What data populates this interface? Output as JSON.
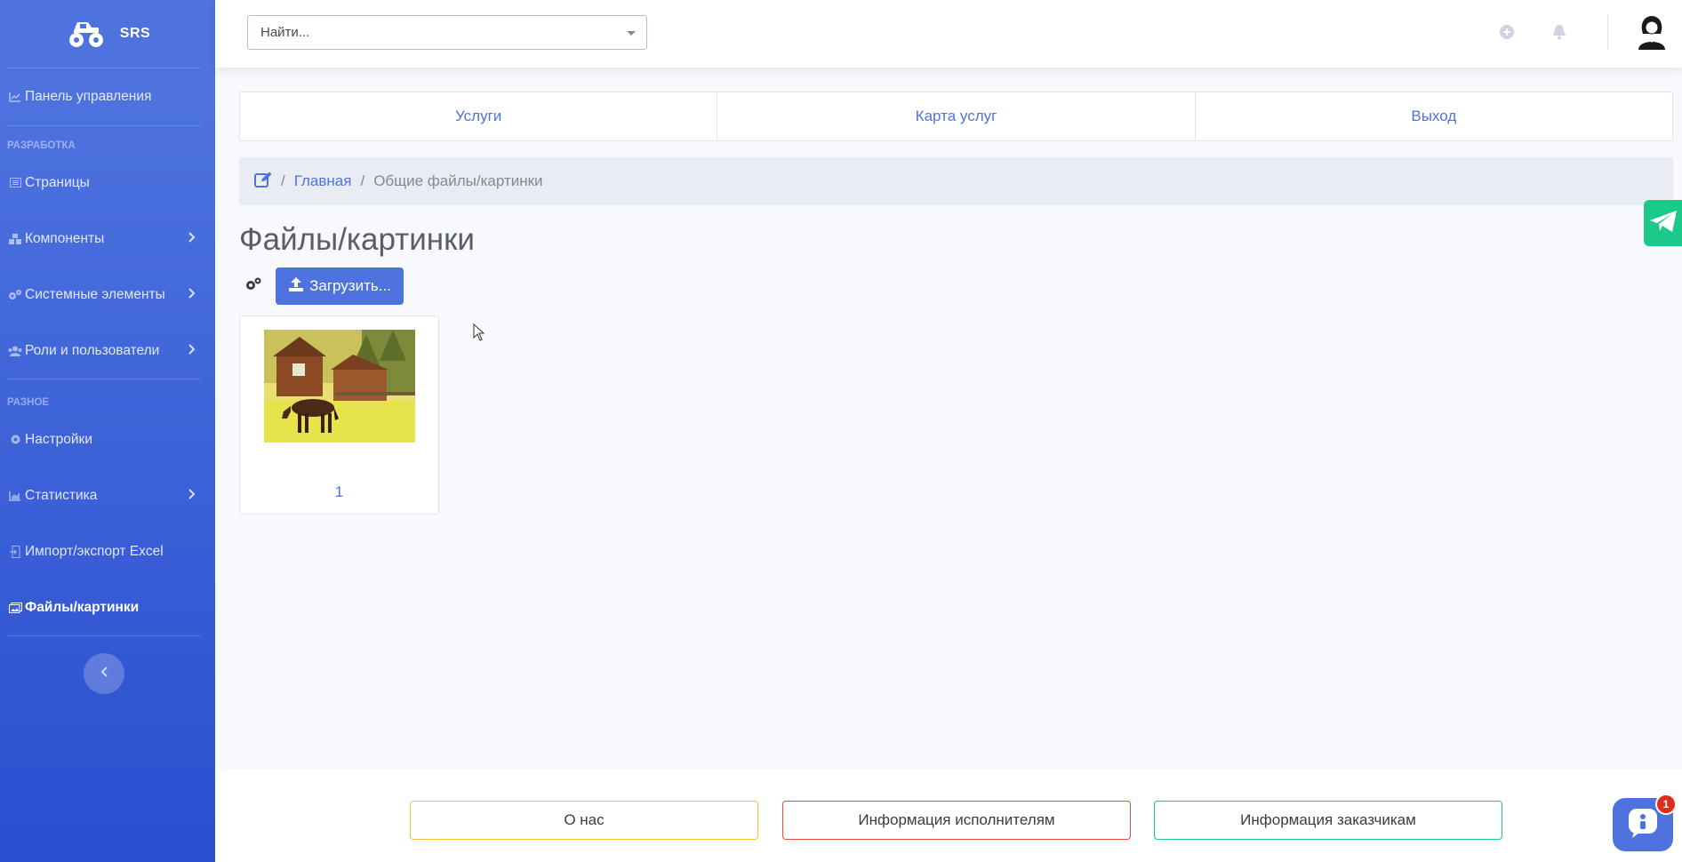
{
  "brand": {
    "name": "SRS"
  },
  "sidebar": {
    "items": [
      {
        "label": "Панель управления",
        "icon": "chart-line-icon"
      },
      {
        "label": "Страницы",
        "icon": "list-icon"
      },
      {
        "label": "Компоненты",
        "icon": "cubes-icon"
      },
      {
        "label": "Системные элементы",
        "icon": "cogs-icon"
      },
      {
        "label": "Роли и пользователи",
        "icon": "users-icon"
      },
      {
        "label": "Настройки",
        "icon": "gear-icon"
      },
      {
        "label": "Статистика",
        "icon": "chart-area-icon"
      },
      {
        "label": "Импорт/экспорт Excel",
        "icon": "file-import-icon"
      },
      {
        "label": "Файлы/картинки",
        "icon": "images-icon"
      }
    ],
    "sections": {
      "dev": "РАЗРАБОТКА",
      "misc": "РАЗНОЕ"
    }
  },
  "search": {
    "placeholder": "Найти..."
  },
  "tabs": [
    {
      "label": "Услуги"
    },
    {
      "label": "Карта услуг"
    },
    {
      "label": "Выход"
    }
  ],
  "breadcrumb": {
    "home": "Главная",
    "current": "Общие файлы/картинки"
  },
  "page": {
    "title": "Файлы/картинки"
  },
  "toolbar": {
    "upload_label": "Загрузить..."
  },
  "files": [
    {
      "name": "1"
    }
  ],
  "footer": {
    "about": "О нас",
    "performers": "Информация исполнителям",
    "customers": "Информация заказчикам"
  },
  "chat": {
    "badge": "1"
  },
  "colors": {
    "primary": "#4e73df",
    "success": "#1cc88a",
    "danger": "#e02d1b"
  }
}
